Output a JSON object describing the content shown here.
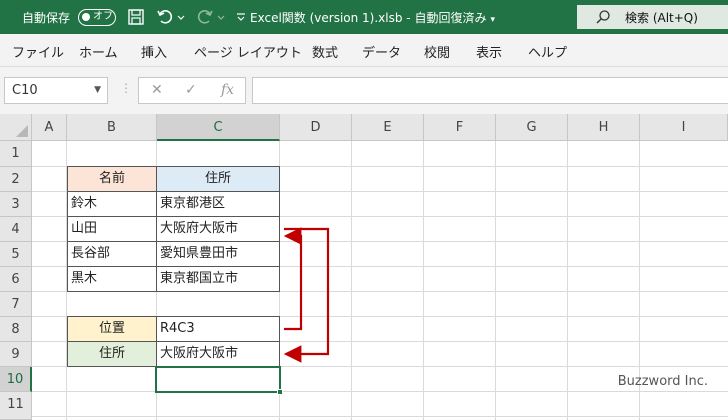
{
  "titlebar": {
    "autosave_label": "自動保存",
    "autosave_state": "オフ",
    "doc_title": "Excel関数 (version 1).xlsb - 自動回復済み",
    "search_label": "検索 (Alt+Q)"
  },
  "ribbon_tabs": [
    "ファイル",
    "ホーム",
    "挿入",
    "ページ レイアウト",
    "数式",
    "データ",
    "校閲",
    "表示",
    "ヘルプ"
  ],
  "formula_bar": {
    "name_box": "C10",
    "cancel_icon": "cancel-icon",
    "enter_icon": "enter-icon",
    "fx_label": "fx",
    "formula": ""
  },
  "columns": [
    "A",
    "B",
    "C",
    "D",
    "E",
    "F",
    "G",
    "H",
    "I"
  ],
  "rows": [
    "1",
    "2",
    "3",
    "4",
    "5",
    "6",
    "7",
    "8",
    "9",
    "10",
    "11"
  ],
  "active_cell": "C10",
  "table": {
    "header_name": "名前",
    "header_address": "住所",
    "rows": [
      {
        "name": "鈴木",
        "address": "東京都港区"
      },
      {
        "name": "山田",
        "address": "大阪府大阪市"
      },
      {
        "name": "長谷部",
        "address": "愛知県豊田市"
      },
      {
        "name": "黒木",
        "address": "東京都国立市"
      }
    ]
  },
  "lookup": {
    "position_label": "位置",
    "position_value": "R4C3",
    "address_label": "住所",
    "address_value": "大阪府大阪市"
  },
  "colors": {
    "accent": "#217346",
    "header_name_fill": "#fce4d6",
    "header_address_fill": "#ddebf7",
    "position_fill": "#fff2cc",
    "address_fill": "#e2efda",
    "arrow": "#c00000"
  },
  "watermark": "Buzzword Inc."
}
